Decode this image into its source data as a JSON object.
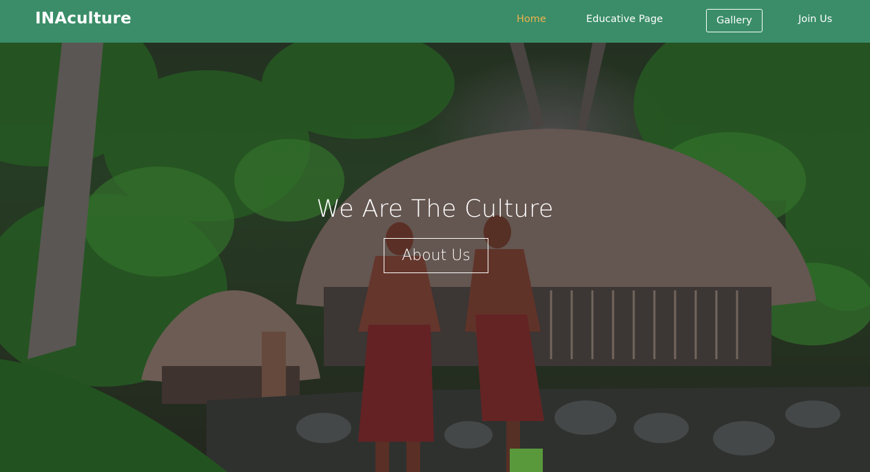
{
  "nav": {
    "logo": "INAculture",
    "links": [
      {
        "label": "Home",
        "active": true
      },
      {
        "label": "Educative Page"
      },
      {
        "label": "Gallery"
      },
      {
        "label": "Join Us"
      }
    ]
  },
  "hero": {
    "title": "We Are The Culture",
    "button_label": "About Us"
  },
  "colors": {
    "navbar_bg": "#3a8d68",
    "active_link": "#f0b24e",
    "text": "#ffffff"
  }
}
